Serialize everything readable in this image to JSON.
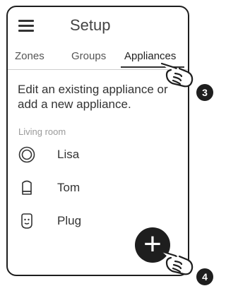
{
  "header": {
    "title": "Setup"
  },
  "tabs": [
    {
      "label": "Zones"
    },
    {
      "label": "Groups"
    },
    {
      "label": "Appliances"
    }
  ],
  "content": {
    "description": "Edit an existing appliance or add a new appliance.",
    "room_label": "Living room",
    "appliances": [
      {
        "label": "Lisa",
        "icon": "round-speaker-icon"
      },
      {
        "label": "Tom",
        "icon": "tall-speaker-icon"
      },
      {
        "label": "Plug",
        "icon": "plug-icon"
      }
    ]
  },
  "fab": {
    "label": "+"
  },
  "steps": [
    {
      "label": "3"
    },
    {
      "label": "4"
    }
  ],
  "colors": {
    "dark": "#1e1e1e",
    "muted": "#9a9a9a"
  }
}
